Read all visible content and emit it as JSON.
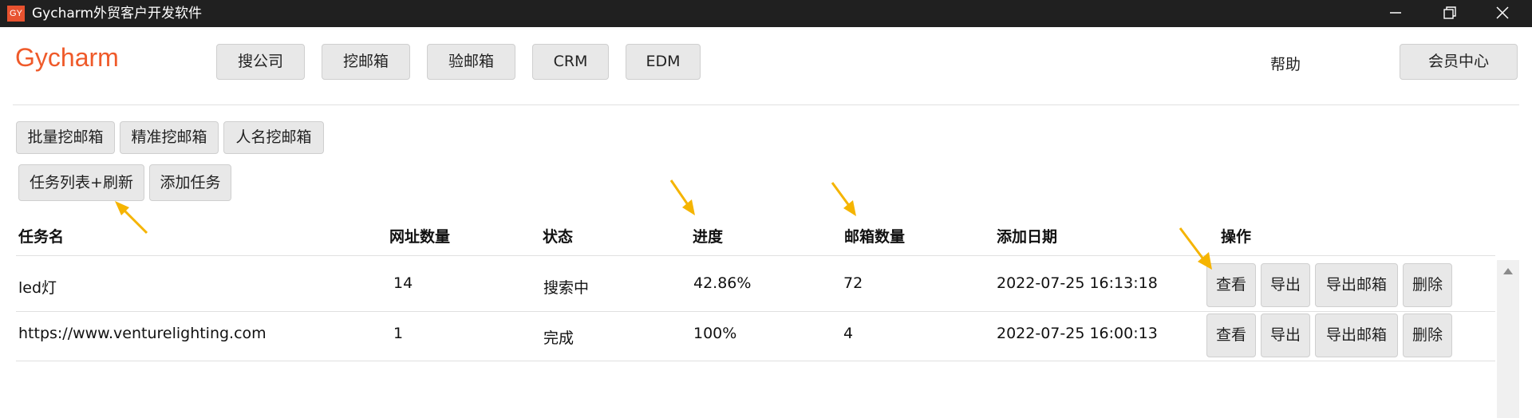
{
  "window": {
    "icon_text": "GY",
    "title": "Gycharm外贸客户开发软件"
  },
  "header": {
    "brand": "Gycharm",
    "nav": [
      "搜公司",
      "挖邮箱",
      "验邮箱",
      "CRM",
      "EDM"
    ],
    "help": "帮助",
    "member": "会员中心"
  },
  "subnav": [
    "批量挖邮箱",
    "精准挖邮箱",
    "人名挖邮箱"
  ],
  "task_actions": [
    "任务列表+刷新",
    "添加任务"
  ],
  "table": {
    "columns": [
      "任务名",
      "网址数量",
      "状态",
      "进度",
      "邮箱数量",
      "添加日期",
      "操作"
    ],
    "rows": [
      {
        "name": "led灯",
        "urls": "14",
        "status": "搜索中",
        "progress": "42.86%",
        "emails": "72",
        "date": "2022-07-25 16:13:18"
      },
      {
        "name": "https://www.venturelighting.com",
        "urls": "1",
        "status": "完成",
        "progress": "100%",
        "emails": "4",
        "date": "2022-07-25 16:00:13"
      }
    ],
    "row_actions": [
      "查看",
      "导出",
      "导出邮箱",
      "删除"
    ]
  },
  "colors": {
    "brand": "#ef5a2a",
    "titlebar": "#202020",
    "annotation_arrow": "#f5b400",
    "button_bg": "#e8e8e8"
  }
}
